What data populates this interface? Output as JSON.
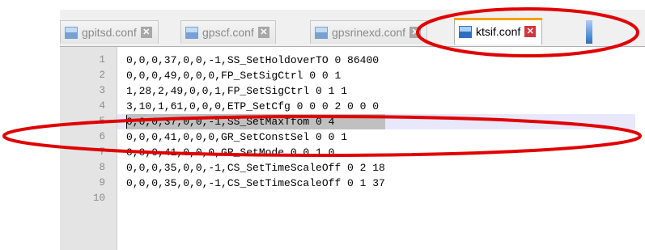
{
  "tabs": [
    {
      "label": "gpitsd.conf",
      "active": false
    },
    {
      "label": "gpscf.conf",
      "active": false
    },
    {
      "label": "gpsrinexd.conf",
      "active": false
    },
    {
      "label": "ktsif.conf",
      "active": true
    }
  ],
  "tab_close_glyph": "✕",
  "icons": {
    "file": "file-icon",
    "close": "close-icon"
  },
  "editor": {
    "line_numbers": [
      "1",
      "2",
      "3",
      "4",
      "5",
      "6",
      "7",
      "8",
      "9",
      "10"
    ],
    "lines": [
      "0,0,0,37,0,0,-1,SS_SetHoldoverTO 0 86400",
      "0,0,0,49,0,0,0,FP_SetSigCtrl 0 0 1",
      "1,28,2,49,0,0,1,FP_SetSigCtrl 0 1 1",
      "3,10,1,61,0,0,0,ETP_SetCfg 0 0 0 2 0 0 0",
      "0,0,0,37,0,0,-1,SS_SetMaxTfom 0 4",
      "0,0,0,41,0,0,0,GR_SetConstSel 0 0 1",
      "0,0,0,41,0,0,0,GR_SetMode 0 0 1 0",
      "0,0,0,35,0,0,-1,CS_SetTimeScaleOff 0 2 18",
      "0,0,0,35,0,0,-1,CS_SetTimeScaleOff 0 1 37",
      ""
    ],
    "current_line": 5
  },
  "colors": {
    "annotation": "#e00000",
    "active_tab_accent": "#f5a000",
    "close_active": "#d4343e",
    "selection": "#c0c0c0"
  }
}
